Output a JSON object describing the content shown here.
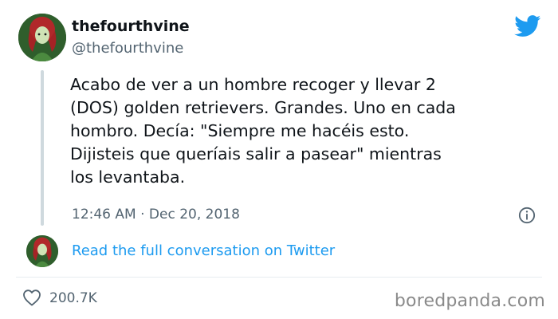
{
  "tweet": {
    "display_name": "thefourthvine",
    "handle": "@thefourthvine",
    "text": "Acabo de ver a un hombre recoger y llevar 2\n(DOS) golden retrievers. Grandes. Uno en cada\nhombro. Decía: \"Siempre me hacéis esto.\nDijisteis que queríais salir a pasear\" mientras\nlos levantaba.",
    "time": "12:46 AM",
    "separator": "·",
    "date": "Dec 20, 2018",
    "conversation_link": "Read the full conversation on Twitter",
    "likes": "200.7K"
  },
  "watermark": "boredpanda.com",
  "colors": {
    "link": "#1d9bf0",
    "twitter_brand": "#1d9bf0",
    "secondary_text": "#536471"
  },
  "icons": [
    "twitter-bird-icon",
    "info-icon",
    "heart-icon"
  ]
}
